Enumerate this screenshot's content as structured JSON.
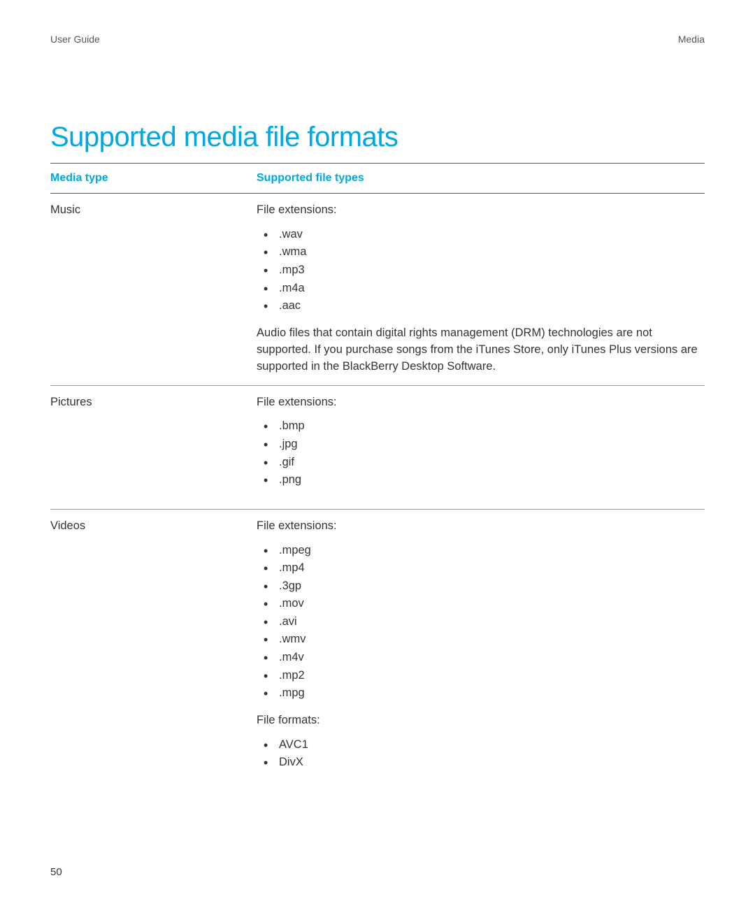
{
  "header": {
    "left": "User Guide",
    "right": "Media"
  },
  "title": "Supported media file formats",
  "columns": {
    "c1": "Media type",
    "c2": "Supported file types"
  },
  "rows": {
    "music": {
      "label": "Music",
      "lead": "File extensions:",
      "items": [
        ".wav",
        ".wma",
        ".mp3",
        ".m4a",
        ".aac"
      ],
      "note": "Audio files that contain digital rights management (DRM) technologies are not supported. If you purchase songs from the iTunes Store, only iTunes Plus versions are supported in the BlackBerry Desktop Software."
    },
    "pictures": {
      "label": "Pictures",
      "lead": "File extensions:",
      "items": [
        ".bmp",
        ".jpg",
        ".gif",
        ".png"
      ]
    },
    "videos": {
      "label": "Videos",
      "lead": "File extensions:",
      "items": [
        ".mpeg",
        ".mp4",
        ".3gp",
        ".mov",
        ".avi",
        ".wmv",
        ".m4v",
        ".mp2",
        ".mpg"
      ],
      "lead2": "File formats:",
      "items2": [
        "AVC1",
        "DivX"
      ]
    }
  },
  "page_number": "50"
}
